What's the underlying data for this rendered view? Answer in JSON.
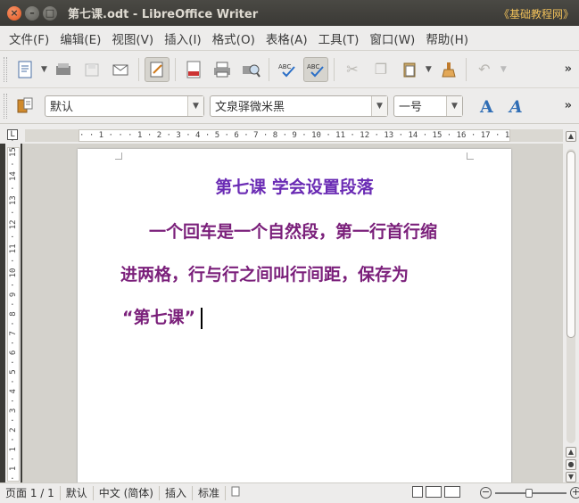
{
  "window": {
    "title": "第七课.odt - LibreOffice Writer",
    "watermark": "《基础教程网》"
  },
  "menu": [
    "文件(F)",
    "编辑(E)",
    "视图(V)",
    "插入(I)",
    "格式(O)",
    "表格(A)",
    "工具(T)",
    "窗口(W)",
    "帮助(H)"
  ],
  "toolbar": {
    "more": "»",
    "style": "默认",
    "font": "文泉驿微米黑",
    "size": "一号"
  },
  "ruler": {
    "corner": "L",
    "horizontal": "· · 1 · · · 1 · 2 · 3 · 4 · 5 · 6 · 7 · 8 · 9 · 10 · 11 · 12 · 13 · 14 · 15 · 16 · 17 · 18 · ·",
    "vertical": "· 1 · 1 · 2 · 3 · 4 · 5 · 6 · 7 · 8 · 9 · 10 · 11 · 12 · 13 · 14 · 15 ·"
  },
  "document": {
    "title": "第七课    学会设置段落",
    "line1": "一个回车是一个自然段，第一行首行缩",
    "line2": "进两格，行与行之间叫行间距，保存为",
    "line3": "“第七课”"
  },
  "status": {
    "page": "页面 1 / 1",
    "style": "默认",
    "language": "中文 (简体)",
    "mode": "插入",
    "selection": "标准"
  },
  "colors": {
    "title": "#6a2bb4",
    "body": "#7a1f7a"
  }
}
